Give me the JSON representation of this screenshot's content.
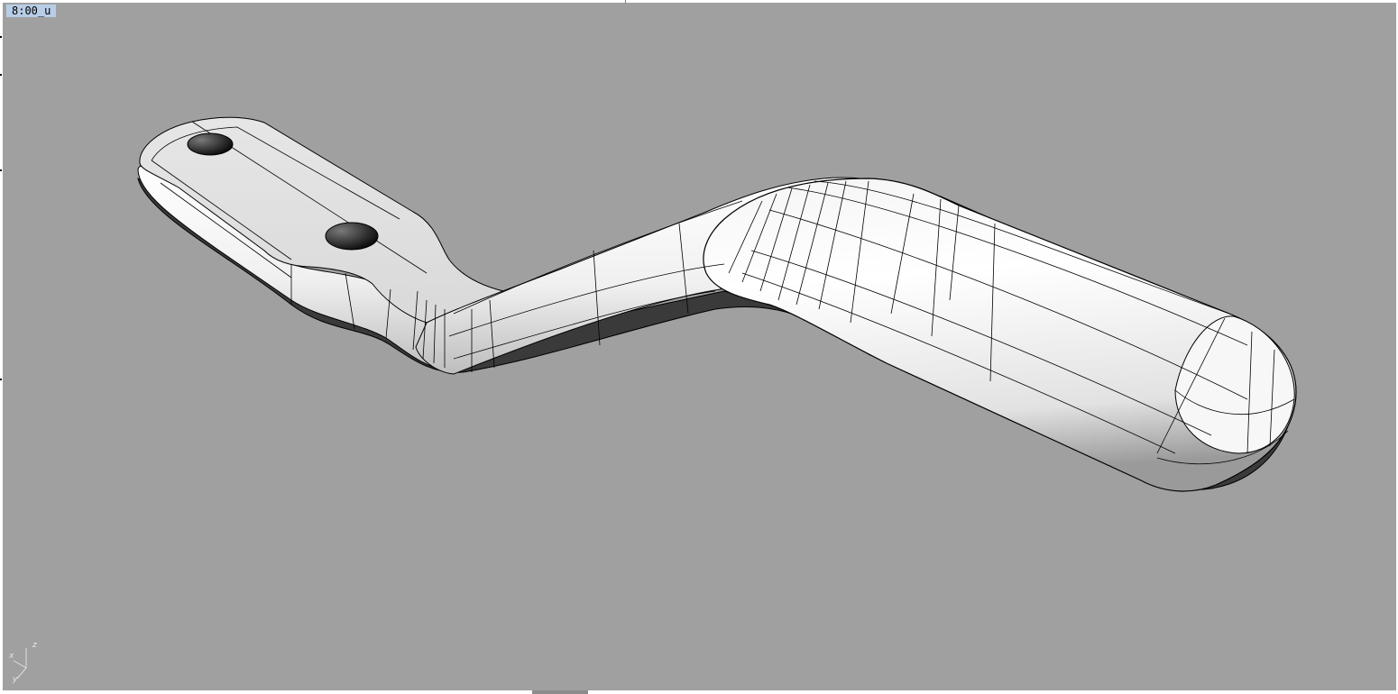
{
  "viewport": {
    "title": "8:00_u",
    "background": "#a0a0a0"
  },
  "axis_widget": {
    "x_label": "x",
    "y_label": "y",
    "z_label": "z"
  },
  "model": {
    "icon": "crank-handle-model",
    "surface_color": "#f2f2f2",
    "edge_color": "#000000"
  }
}
